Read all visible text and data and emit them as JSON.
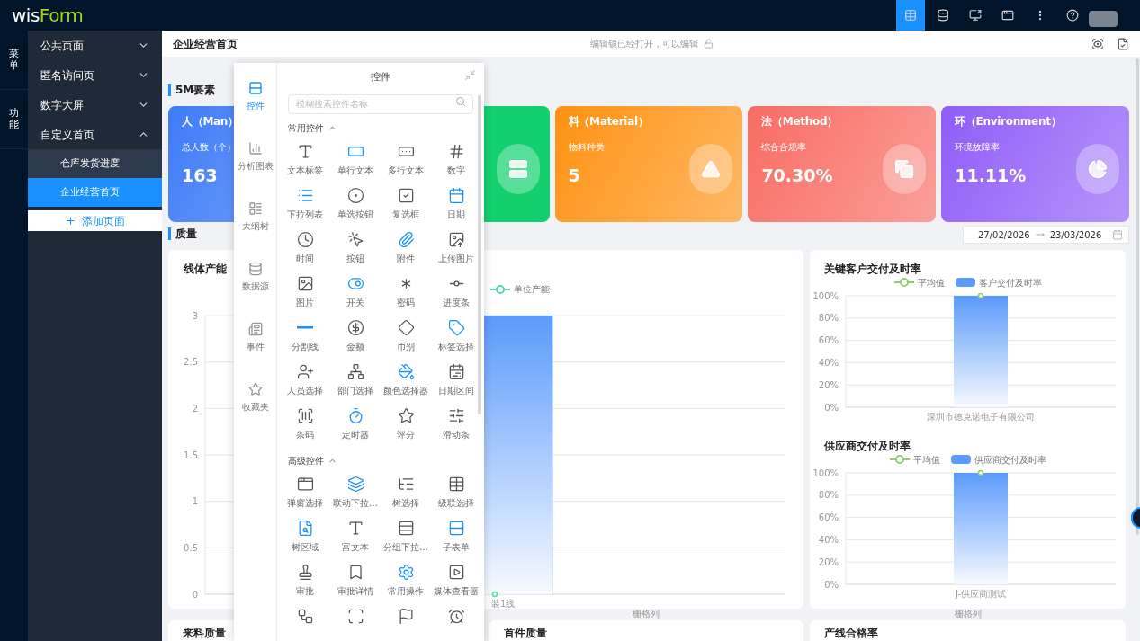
{
  "app": {
    "logo_part1": "wis",
    "logo_part2": "Form"
  },
  "toolbar": [
    {
      "selected": true
    },
    {
      "selected": false
    },
    {
      "selected": false
    },
    {
      "selected": false
    },
    {
      "selected": false
    },
    {
      "selected": false
    }
  ],
  "rail": [
    {
      "label": "菜单"
    },
    {
      "label": "功能"
    }
  ],
  "menu": [
    {
      "label": "公共页面",
      "expanded": false
    },
    {
      "label": "匿名访问页",
      "expanded": false
    },
    {
      "label": "数字大屏",
      "expanded": false
    },
    {
      "label": "自定义首页",
      "expanded": true,
      "children": [
        {
          "label": "仓库发货进度",
          "selected": false
        },
        {
          "label": "企业经营首页",
          "selected": true
        }
      ]
    }
  ],
  "add_page": "添加页面",
  "page_header": {
    "title": "企业经营首页",
    "lock_status": "编辑锁已经打开，可以编辑"
  },
  "section_5m": {
    "title": "5M要素",
    "cards": [
      {
        "title": "人（Man）",
        "label": "总人数（个）",
        "value": "163",
        "color": "#3d7bf7",
        "gradient": true
      },
      {
        "color": "#12d06e",
        "gradient": false
      },
      {
        "title": "料（Material）",
        "label": "物料种类",
        "value": "5",
        "color": "#ff9112",
        "gradient": true
      },
      {
        "title": "法（Method）",
        "label": "综合合规率",
        "value": "70.30%",
        "color": "#f86c62",
        "gradient": true
      },
      {
        "title": "环（Environment）",
        "label": "环境故障率",
        "value": "11.11%",
        "color": "#8f5cf7",
        "gradient": true
      }
    ]
  },
  "quality": {
    "title": "质量",
    "date_start": "27/02/2026",
    "date_end": "23/03/2026",
    "charts": [
      {
        "title": "线体产能",
        "chart_data": {
          "type": "bar",
          "grid": true,
          "categories": [
            "装1线"
          ],
          "ylim": [
            0,
            3
          ],
          "yticks": [
            0,
            0.5,
            1,
            1.5,
            2,
            2.5,
            3
          ],
          "series": [
            {
              "color": "#5b9bfb",
              "values": [
                3
              ]
            },
            {
              "name": "单位产能",
              "color": "#5ad8a6",
              "values": [
                0
              ]
            }
          ]
        }
      },
      {
        "title": "关键客户交付及时率",
        "chart_data": {
          "type": "bar",
          "grid": true,
          "categories": [
            "深圳市德克诺电子有限公司"
          ],
          "ylim": [
            0,
            100
          ],
          "yticks": [
            {
              "value": 0,
              "label": "0%"
            },
            {
              "value": 20,
              "label": "20%"
            },
            {
              "value": 40,
              "label": "40%"
            },
            {
              "value": 60,
              "label": "60%"
            },
            {
              "value": 80,
              "label": "80%"
            },
            {
              "value": 100,
              "label": "100%"
            }
          ],
          "series": [
            {
              "name": "客户交付及时率",
              "color": "#5b9bfb",
              "values": [
                100
              ]
            }
          ]
        },
        "average_marker": {
          "label": "平均值",
          "color": "#91cc75"
        }
      },
      {
        "title": "供应商交付及时率",
        "chart_data": {
          "type": "bar",
          "grid": true,
          "categories": [
            "J-供应商测试"
          ],
          "ylim": [
            0,
            100
          ],
          "yticks": [
            {
              "value": 0,
              "label": "0%"
            },
            {
              "value": 20,
              "label": "20%"
            },
            {
              "value": 40,
              "label": "40%"
            },
            {
              "value": 60,
              "label": "60%"
            },
            {
              "value": 80,
              "label": "80%"
            },
            {
              "value": 100,
              "label": "100%"
            }
          ],
          "series": [
            {
              "name": "供应商交付及时率",
              "color": "#5b9bfb",
              "values": [
                100
              ]
            }
          ]
        },
        "average_marker": {
          "label": "平均值",
          "color": "#91cc75"
        }
      }
    ],
    "grid_column_labels": [
      "栅格列",
      "栅格列"
    ],
    "bottom_cards": [
      "来料质量",
      "首件质量",
      "产线合格率"
    ]
  },
  "panel": {
    "title": "控件",
    "search": {
      "placeholder": "模糊搜索控件名称"
    },
    "nav": [
      {
        "label": "控件",
        "selected": true
      },
      {
        "label": "分析图表",
        "selected": false
      },
      {
        "label": "大纲树",
        "selected": false
      },
      {
        "label": "数据源",
        "selected": false
      },
      {
        "label": "事件",
        "selected": false
      },
      {
        "label": "收藏夹",
        "selected": false
      }
    ],
    "groups": [
      {
        "title": "常用控件",
        "expanded": true,
        "items": [
          {
            "kind": "tool",
            "label": "文本标签"
          },
          {
            "kind": "tool",
            "label": "单行文本"
          },
          {
            "kind": "tool",
            "label": "多行文本"
          },
          {
            "kind": "tool",
            "label": "数字"
          },
          {
            "kind": "tool",
            "label": "下拉列表"
          },
          {
            "kind": "tool",
            "label": "单选按钮"
          },
          {
            "kind": "tool",
            "label": "复选框"
          },
          {
            "kind": "tool",
            "label": "日期"
          },
          {
            "kind": "tool",
            "label": "时间"
          },
          {
            "kind": "tool",
            "label": "按钮"
          },
          {
            "kind": "tool",
            "label": "附件"
          },
          {
            "kind": "tool",
            "label": "上传图片"
          },
          {
            "kind": "tool",
            "label": "图片"
          },
          {
            "kind": "tool",
            "label": "开关"
          },
          {
            "kind": "tool",
            "label": "密码"
          },
          {
            "kind": "tool",
            "label": "进度条"
          },
          {
            "kind": "tool",
            "label": "分割线"
          },
          {
            "kind": "tool",
            "label": "金额"
          },
          {
            "kind": "tool",
            "label": "币别"
          },
          {
            "kind": "tool",
            "label": "标签选择"
          },
          {
            "kind": "tool",
            "label": "人员选择"
          },
          {
            "kind": "tool",
            "label": "部门选择"
          },
          {
            "kind": "tool",
            "label": "颜色选择器"
          },
          {
            "kind": "tool",
            "label": "日期区间"
          },
          {
            "kind": "tool",
            "label": "条码"
          },
          {
            "kind": "tool",
            "label": "定时器"
          },
          {
            "kind": "tool",
            "label": "评分"
          },
          {
            "kind": "tool",
            "label": "滑动条"
          }
        ]
      },
      {
        "title": "高级控件",
        "expanded": true,
        "items": [
          {
            "kind": "tool",
            "label": "弹窗选择"
          },
          {
            "kind": "tool",
            "label": "联动下拉…"
          },
          {
            "kind": "tool",
            "label": "树选择"
          },
          {
            "kind": "tool",
            "label": "级联选择"
          },
          {
            "kind": "tool",
            "label": "树区域"
          },
          {
            "kind": "tool",
            "label": "富文本"
          },
          {
            "kind": "tool",
            "label": "分组下拉…"
          },
          {
            "kind": "tool",
            "label": "子表单"
          },
          {
            "kind": "tool",
            "label": "审批"
          },
          {
            "kind": "tool",
            "label": "审批详情"
          },
          {
            "kind": "tool",
            "label": "常用操作"
          },
          {
            "kind": "tool",
            "label": "媒体查看器"
          },
          {
            "kind": "icon_only"
          },
          {
            "kind": "icon_only"
          },
          {
            "kind": "icon_only"
          },
          {
            "kind": "icon_only"
          }
        ]
      }
    ]
  }
}
